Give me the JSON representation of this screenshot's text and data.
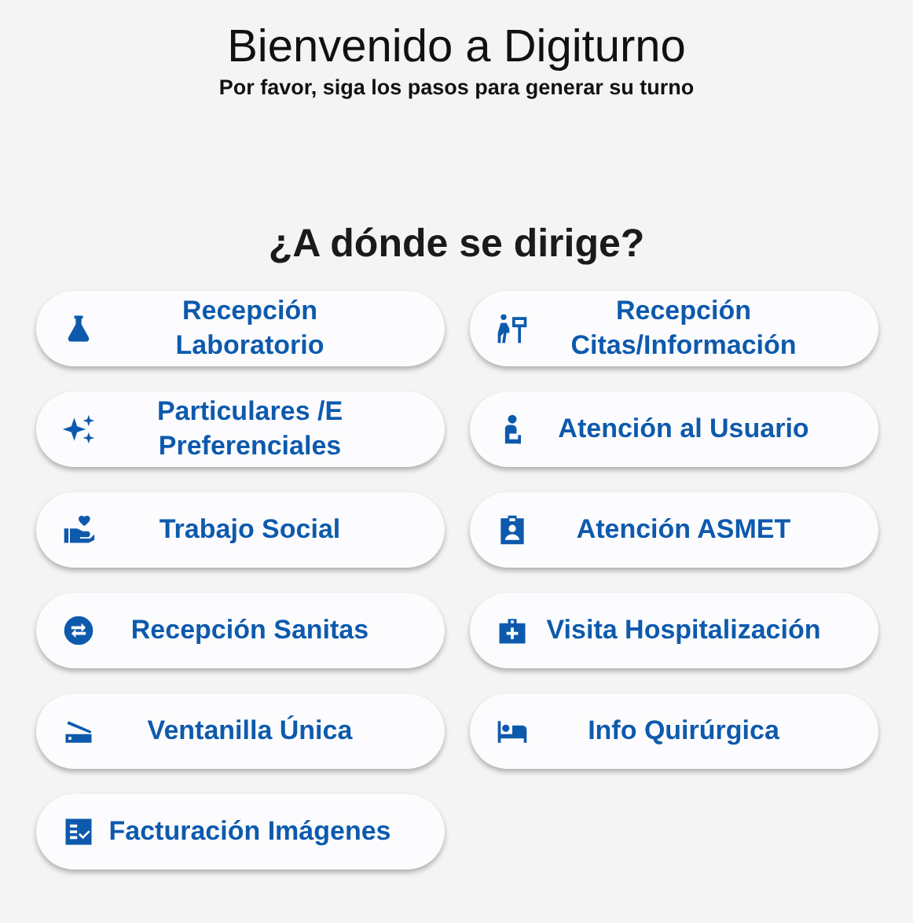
{
  "header": {
    "title": "Bienvenido a Digiturno",
    "subtitle": "Por favor, siga los pasos para generar su turno"
  },
  "question": "¿A dónde se dirige?",
  "options": [
    {
      "label": "Recepción Laboratorio"
    },
    {
      "label": "Recepción Citas/Información"
    },
    {
      "label": "Particulares /E Preferenciales"
    },
    {
      "label": "Atención al Usuario"
    },
    {
      "label": "Trabajo Social"
    },
    {
      "label": "Atención ASMET"
    },
    {
      "label": "Recepción Sanitas"
    },
    {
      "label": "Visita Hospitalización"
    },
    {
      "label": "Ventanilla Única"
    },
    {
      "label": "Info Quirúrgica"
    },
    {
      "label": "Facturación Imágenes"
    }
  ]
}
